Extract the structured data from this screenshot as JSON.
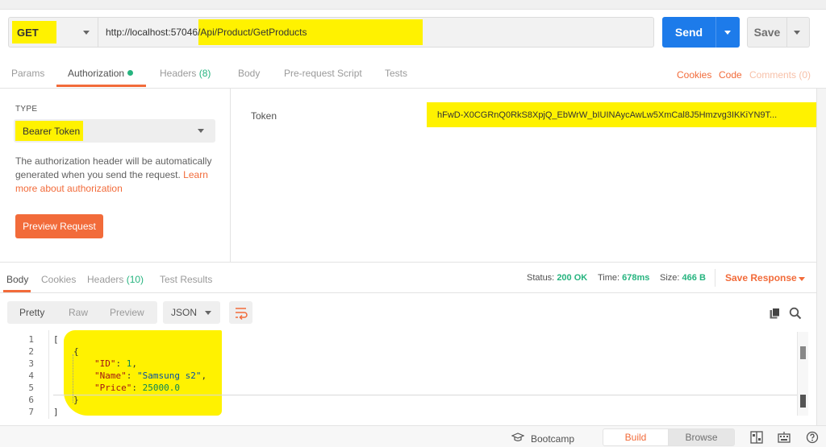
{
  "request": {
    "method": "GET",
    "url": "http://localhost:57046/Api/Product/GetProducts",
    "send_label": "Send",
    "save_label": "Save"
  },
  "request_tabs": {
    "params": "Params",
    "authorization": "Authorization",
    "headers": "Headers",
    "headers_count": "(8)",
    "body": "Body",
    "pre_request": "Pre-request Script",
    "tests": "Tests",
    "cookies": "Cookies",
    "code": "Code",
    "comments": "Comments (0)"
  },
  "auth": {
    "type_label": "TYPE",
    "type_value": "Bearer Token",
    "description": "The authorization header will be automatically generated when you send the request.",
    "learn_more": "Learn more about authorization",
    "preview_button": "Preview Request",
    "token_label": "Token",
    "token_value": "hFwD-X0CGRnQ0RkS8XpjQ_EbWrW_bIUINAycAwLw5XmCal8J5Hmzvg3IKKiYN9T..."
  },
  "response_tabs": {
    "body": "Body",
    "cookies": "Cookies",
    "headers": "Headers",
    "headers_count": "(10)",
    "test_results": "Test Results"
  },
  "response_meta": {
    "status_label": "Status:",
    "status_value": "200 OK",
    "time_label": "Time:",
    "time_value": "678ms",
    "size_label": "Size:",
    "size_value": "466 B",
    "save_response": "Save Response"
  },
  "view": {
    "pretty": "Pretty",
    "raw": "Raw",
    "preview": "Preview",
    "format": "JSON"
  },
  "code": {
    "line_numbers": [
      "1",
      "2",
      "3",
      "4",
      "5",
      "6",
      "7"
    ],
    "open_bracket": "[",
    "open_brace": "{",
    "id_key": "\"ID\"",
    "id_value": "1",
    "name_key": "\"Name\"",
    "name_value": "\"Samsung s2\"",
    "price_key": "\"Price\"",
    "price_value": "25000.0",
    "close_brace": "}",
    "close_bracket": "]"
  },
  "statusbar": {
    "bootcamp": "Bootcamp",
    "build": "Build",
    "browse": "Browse"
  },
  "colors": {
    "accent": "#f26b3a",
    "send_blue": "#1d7bea",
    "success_green": "#26b47f",
    "highlight_yellow": "#fff200"
  },
  "icons": [
    "chevron-down-icon",
    "wrap-lines-icon",
    "copy-icon",
    "search-icon",
    "graduation-cap-icon",
    "two-pane-icon",
    "keyboard-icon",
    "help-icon"
  ]
}
